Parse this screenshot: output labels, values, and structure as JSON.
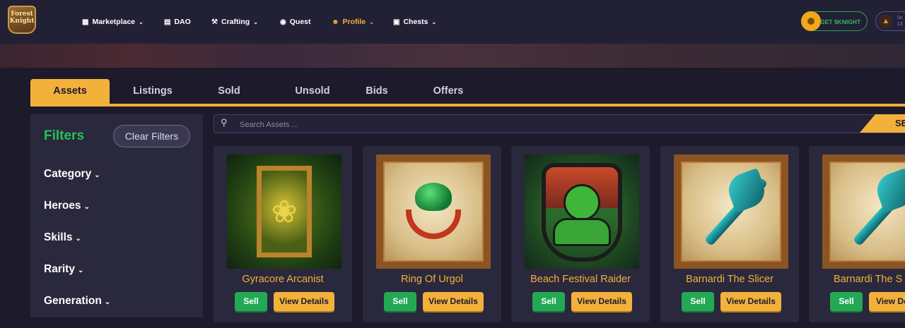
{
  "header": {
    "logo_text": "Forest Knight",
    "nav": [
      {
        "label": "Marketplace",
        "icon": "store-icon",
        "dropdown": true
      },
      {
        "label": "DAO",
        "icon": "dao-icon",
        "dropdown": false
      },
      {
        "label": "Crafting",
        "icon": "hammer-icon",
        "dropdown": true
      },
      {
        "label": "Quest",
        "icon": "quest-icon",
        "dropdown": false
      },
      {
        "label": "Profile",
        "icon": "user-icon",
        "dropdown": true
      },
      {
        "label": "Chests",
        "icon": "chest-icon",
        "dropdown": true
      }
    ],
    "cta_label": "GET $KNIGHT",
    "wallet_line1": "0x",
    "wallet_line2": "13"
  },
  "tabs": [
    "Assets",
    "Listings",
    "Sold",
    "Unsold",
    "Bids",
    "Offers"
  ],
  "active_tab": "Assets",
  "filters": {
    "title": "Filters",
    "clear_label": "Clear Filters",
    "groups": [
      "Category",
      "Heroes",
      "Skills",
      "Rarity",
      "Generation"
    ]
  },
  "search": {
    "placeholder": "Search Assets ...",
    "button_label": "SE"
  },
  "cards": [
    {
      "name": "Gyracore Arcanist",
      "sell_label": "Sell",
      "details_label": "View Details"
    },
    {
      "name": "Ring Of Urgol",
      "sell_label": "Sell",
      "details_label": "View Details"
    },
    {
      "name": "Beach Festival Raider",
      "sell_label": "Sell",
      "details_label": "View Details"
    },
    {
      "name": "Barnardi The Slicer",
      "sell_label": "Sell",
      "details_label": "View Details"
    },
    {
      "name": "Barnardi The S",
      "sell_label": "Sell",
      "details_label": "View De"
    }
  ],
  "colors": {
    "accent": "#f2b13b",
    "success": "#23a955",
    "filters_title": "#23c35b",
    "background": "#1d1a2c"
  }
}
